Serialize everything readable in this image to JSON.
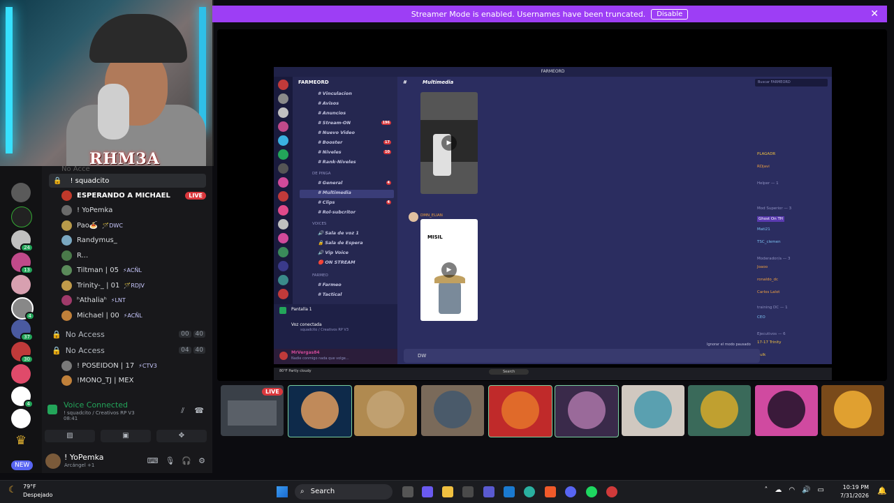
{
  "banner": {
    "text": "Streamer Mode is enabled. Usernames have been truncated.",
    "button": "Disable",
    "close": "✕"
  },
  "webcam": {
    "overlay": "RHM3A"
  },
  "rail": {
    "badges": [
      "24",
      "13",
      "4",
      "37",
      "30",
      "4"
    ],
    "new_label": "NEW"
  },
  "sidebar": {
    "top_cut": "No Acce",
    "channel": "! squadcito",
    "members": [
      {
        "name": "ESPERANDO A MICHAEL",
        "tag": "",
        "live": "LIVE",
        "color": "#c0392b"
      },
      {
        "name": "! YoPemka",
        "tag": "",
        "live": "",
        "color": "#6a6a6a"
      },
      {
        "name": "Pao🍝",
        "tag": "🪄DWC",
        "live": "",
        "color": "#b89a4a"
      },
      {
        "name": "Randymus_",
        "tag": "",
        "live": "",
        "color": "#7aa7c0"
      },
      {
        "name": "R...",
        "tag": "",
        "live": "",
        "color": "#4a7a4a"
      },
      {
        "name": "Tiltman | 05",
        "tag": "⚡ACÑL",
        "live": "",
        "color": "#5a8a5a"
      },
      {
        "name": "Trinity-_ | 01",
        "tag": "🪄RDJV",
        "live": "",
        "color": "#c09a4a"
      },
      {
        "name": "ʰAthaliaʰ",
        "tag": "⚡LNT",
        "live": "",
        "color": "#a03a6a"
      },
      {
        "name": "Michael | 00",
        "tag": "⚡ACÑL",
        "live": "",
        "color": "#c0803a"
      }
    ],
    "no_access": [
      {
        "label": "No Access",
        "n1": "00",
        "n2": "40"
      },
      {
        "label": "No Access",
        "n1": "04",
        "n2": "40"
      }
    ],
    "extra": [
      {
        "name": "! POSEIDON | 17",
        "tag": "⚡CTV3",
        "color": "#7a7a7a"
      },
      {
        "name": "!MONO_TJ | MEX",
        "tag": "",
        "color": "#c0803a"
      }
    ]
  },
  "voice": {
    "title": "Voice Connected",
    "sub": "! squadcito / Creativos RP V3",
    "time": "08:41"
  },
  "user": {
    "name": "! YoPemka",
    "status": "Arcángel +1"
  },
  "discord": {
    "title": "FARMEORD",
    "server": "FARMEORD",
    "channel_title": "Multimedia",
    "search": "Buscar FARMEORD",
    "channels": [
      {
        "name": "Vinculacion",
        "badge": ""
      },
      {
        "name": "Avisos",
        "badge": ""
      },
      {
        "name": "Anuncios",
        "badge": ""
      },
      {
        "name": "Stream-ON",
        "badge": "196"
      },
      {
        "name": "Nuevo Video",
        "badge": ""
      },
      {
        "name": "Booster",
        "badge": "17"
      },
      {
        "name": "Niveles",
        "badge": "10"
      },
      {
        "name": "Rank-Niveles",
        "badge": ""
      }
    ],
    "cat_pinga": "DE PINGA",
    "pinga_channels": [
      {
        "name": "General",
        "badge": "4"
      },
      {
        "name": "Multimedia",
        "badge": ""
      },
      {
        "name": "Clips",
        "badge": "4"
      },
      {
        "name": "Rol-subcritor",
        "badge": ""
      }
    ],
    "cat_voices": "VOICES",
    "voice_channels": [
      "Sala de voz 1",
      "Sala de Espera",
      "Vip Voice",
      "ON STREAM"
    ],
    "cat_farmeo": "FARMEO",
    "farmeo_channels": [
      "Farmeo",
      "Tactical"
    ],
    "screen": "Pantalla 1",
    "voice_conn": "Voz conectada",
    "voice_sub": "squadcito / Creativos RP V3",
    "author": "DMN_ELIAN",
    "media_text": "MISIL",
    "input": "DW",
    "member_sections": [
      "PLAGADR",
      "RDjavi",
      "Helper — 1",
      "Mod Superior — 3",
      "Ghost On TH",
      "Mati21",
      "TSC_clemen",
      "Moderador/a — 3",
      "Joaoo",
      "ronaldo_dc",
      "Carlos Lalot",
      "training DC — 1",
      "CEO",
      "Ejecutivos — 6",
      "17-17 Trinity",
      "Hulk"
    ],
    "status_note": "Ignorar el modo pausado",
    "user_name": "MrVergas84",
    "user_status": "Nadie conmigo nada que volge...",
    "weather": "80°F Partly cloudy",
    "tb_search": "Search"
  },
  "tiles": {
    "live": "LIVE"
  },
  "taskbar": {
    "temp": "79°F",
    "weather": "Despejado",
    "search": "Search",
    "time": "10:19 PM",
    "date": "7/31/2026"
  }
}
